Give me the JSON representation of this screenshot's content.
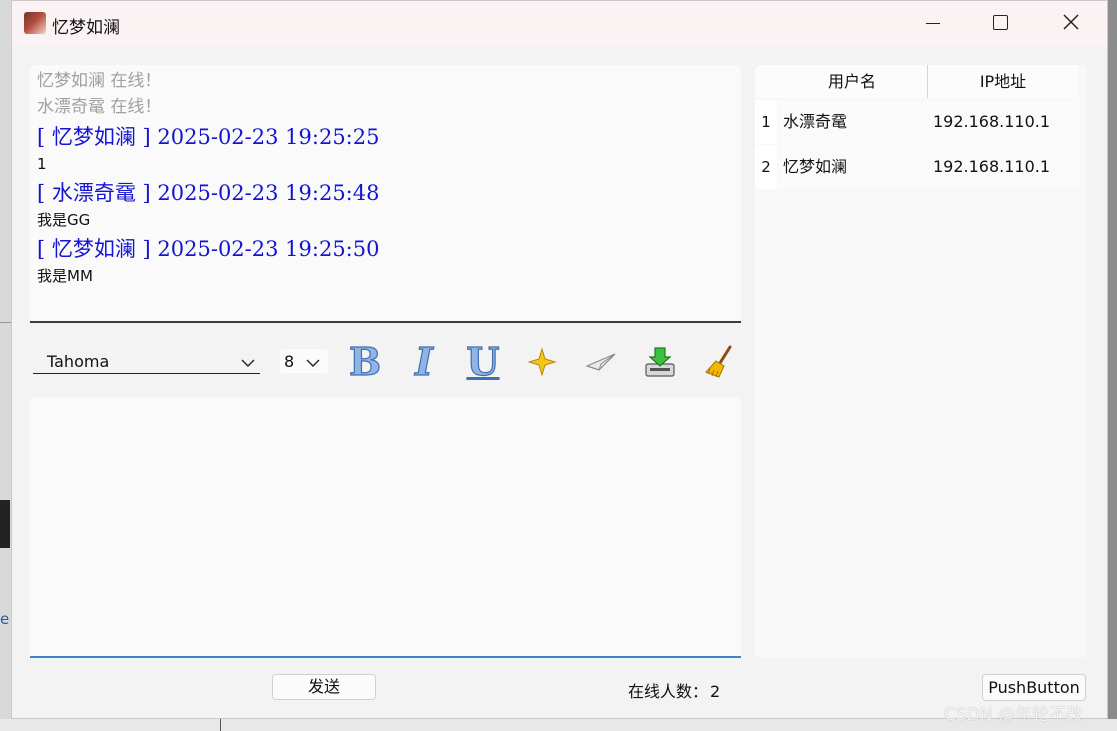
{
  "window": {
    "title": "忆梦如澜"
  },
  "chat": {
    "system_lines": [
      "忆梦如澜 在线！",
      "水漂奇鼋 在线！"
    ],
    "messages": [
      {
        "header": "[ 忆梦如澜 ] 2025-02-23 19:25:25",
        "body": "1"
      },
      {
        "header": "[ 水漂奇鼋 ] 2025-02-23 19:25:48",
        "body": "我是GG"
      },
      {
        "header": "[ 忆梦如澜 ] 2025-02-23 19:25:50",
        "body": "我是MM"
      }
    ]
  },
  "toolbar": {
    "font_family": "Tahoma",
    "font_size": "8",
    "bold_label": "B",
    "italic_label": "I",
    "underline_label": "U",
    "icons": [
      "bold-icon",
      "italic-icon",
      "underline-icon",
      "text-color-icon",
      "send-file-icon",
      "save-icon",
      "clear-icon"
    ]
  },
  "send_button_label": "发送",
  "online": {
    "label": "在线人数：",
    "count": "2"
  },
  "user_table": {
    "headers": [
      "用户名",
      "IP地址"
    ],
    "rows": [
      {
        "num": "1",
        "name": "水漂奇鼋",
        "ip": "192.168.110.1"
      },
      {
        "num": "2",
        "name": "忆梦如澜",
        "ip": "192.168.110.1"
      }
    ]
  },
  "push_button_label": "PushButton",
  "watermark": "CSDN @年轮不改",
  "background": {
    "edge_link_text": "er"
  },
  "colors": {
    "message_header": "#1414d2",
    "system_text": "#a0a0a0",
    "input_focus": "#3d84c6"
  }
}
